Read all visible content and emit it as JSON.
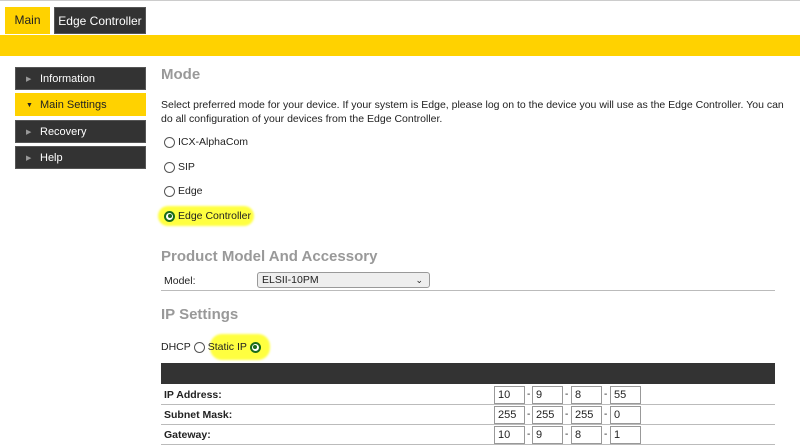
{
  "tabs": [
    {
      "label": "Main",
      "active": true
    },
    {
      "label": "Edge Controller",
      "active": false
    }
  ],
  "sidebar": {
    "items": [
      {
        "label": "Information"
      },
      {
        "label": "Main Settings",
        "active": true
      },
      {
        "label": "Recovery"
      },
      {
        "label": "Help"
      }
    ]
  },
  "mode": {
    "title": "Mode",
    "description": "Select preferred mode for your device. If your system is Edge, please log on to the device you will use as the Edge Controller. You can do all configuration of your devices from the Edge Controller.",
    "options": [
      {
        "label": "ICX-AlphaCom",
        "selected": false
      },
      {
        "label": "SIP",
        "selected": false
      },
      {
        "label": "Edge",
        "selected": false
      },
      {
        "label": "Edge Controller",
        "selected": true
      }
    ]
  },
  "product": {
    "title": "Product Model And Accessory",
    "model_label": "Model:",
    "model_value": "ELSII-10PM"
  },
  "ip": {
    "title": "IP Settings",
    "dhcp_label": "DHCP",
    "static_label": "Static IP",
    "mode": "Static IP",
    "rows": [
      {
        "label": "IP Address:",
        "octets": [
          "10",
          "9",
          "8",
          "55"
        ]
      },
      {
        "label": "Subnet Mask:",
        "octets": [
          "255",
          "255",
          "255",
          "0"
        ]
      },
      {
        "label": "Gateway:",
        "octets": [
          "10",
          "9",
          "8",
          "1"
        ]
      }
    ]
  },
  "colors": {
    "accent": "#ffd200",
    "dark": "#333333",
    "highlight": "#ffff40",
    "radio_selected": "#1a6b1a"
  }
}
